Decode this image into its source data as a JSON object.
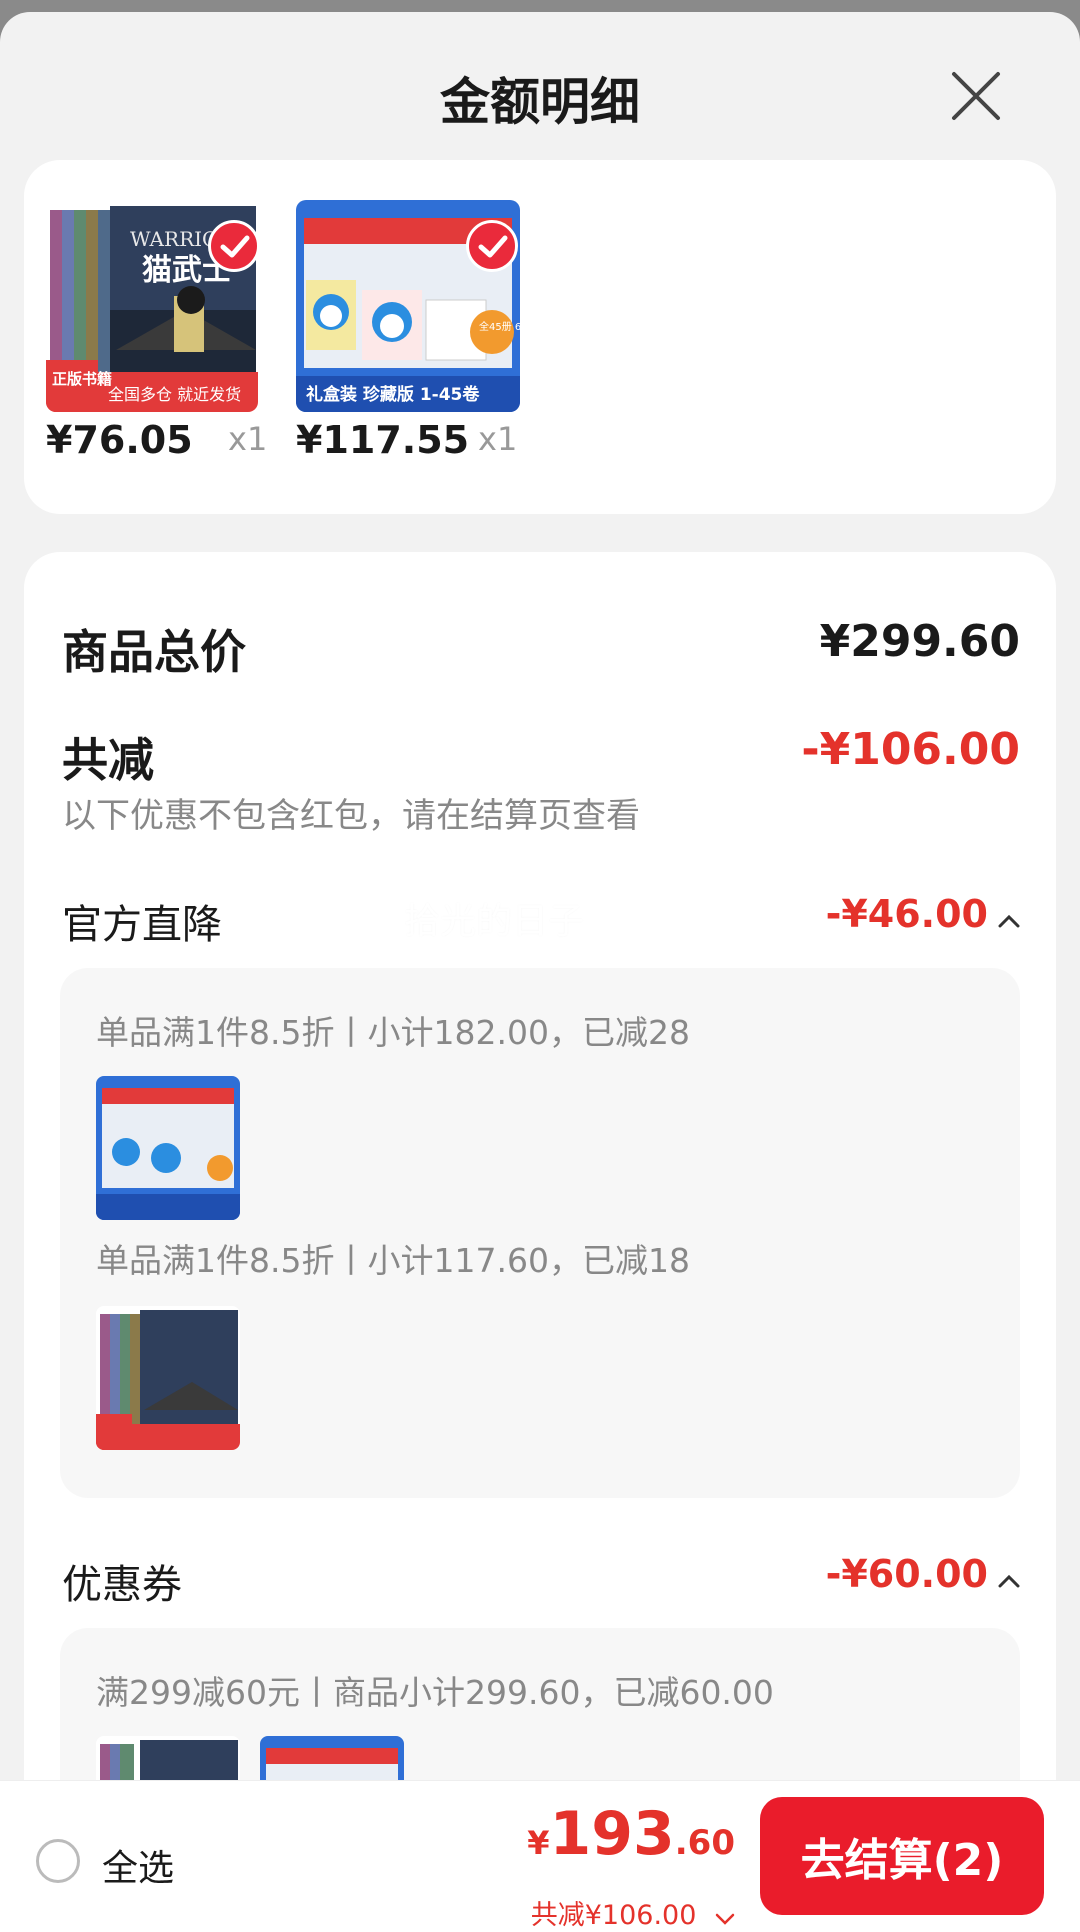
{
  "header": {
    "title": "金额明细"
  },
  "products": [
    {
      "price": "¥76.05",
      "qty": "x1",
      "cover": "warriors"
    },
    {
      "price": "¥117.55",
      "qty": "x1",
      "cover": "doraemon"
    }
  ],
  "summary": {
    "total_label": "商品总价",
    "total_value": "¥299.60",
    "discount_label": "共减",
    "discount_value": "-¥106.00",
    "discount_note": "以下优惠不包含红包，请在结算页查看"
  },
  "watermark": "拾光的日子",
  "official": {
    "label": "官方直降",
    "value": "-¥46.00",
    "promo1": "单品满1件8.5折丨小计182.00，已减28",
    "promo2": "单品满1件8.5折丨小计117.60，已减18"
  },
  "coupon": {
    "label": "优惠券",
    "value": "-¥60.00",
    "promo": "满299减60元丨商品小计299.60，已减60.00"
  },
  "bottom": {
    "select_all": "全选",
    "currency": "¥",
    "total_int": "193",
    "total_dec": ".60",
    "saved": "共减¥106.00",
    "checkout": "去结算(2)"
  },
  "colors": {
    "accent": "#e4322b",
    "button": "#ea1c2b"
  },
  "cover_texts": {
    "warriors_brand": "WARRIORS",
    "warriors_title": "猫武士",
    "warriors_badge": "正版书籍",
    "warriors_banner": "全国多仓 就近发货",
    "dora_banner": "礼盒装 珍藏版 1-45卷",
    "dora_sticker": "全45册 64开本"
  }
}
